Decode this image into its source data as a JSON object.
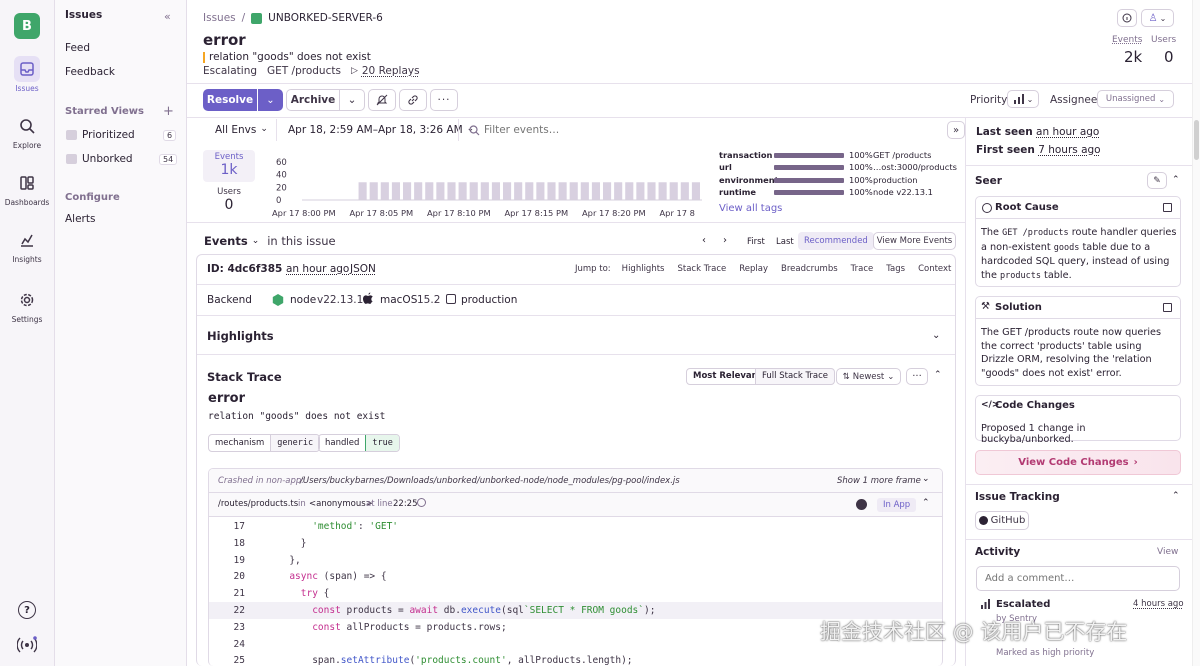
{
  "org_initial": "B",
  "nav": {
    "issues": "Issues",
    "explore": "Explore",
    "dashboards": "Dashboards",
    "insights": "Insights",
    "settings": "Settings"
  },
  "secnav": {
    "title": "Issues",
    "feed": "Feed",
    "feedback": "Feedback",
    "starred_views": "Starred Views",
    "prioritized": "Prioritized",
    "prioritized_count": "6",
    "unborked": "Unborked",
    "unborked_count": "54",
    "configure": "Configure",
    "alerts": "Alerts"
  },
  "breadcrumb": {
    "root": "Issues",
    "project": "UNBORKED-SERVER-6"
  },
  "issue": {
    "title": "error",
    "message": "relation \"goods\" does not exist",
    "status": "Escalating",
    "transaction": "GET /products",
    "replays": "20 Replays",
    "events_label": "Events",
    "events_value": "2k",
    "users_label": "Users",
    "users_value": "0"
  },
  "actions": {
    "resolve": "Resolve",
    "archive": "Archive",
    "priority_label": "Priority",
    "assignee_label": "Assignee",
    "assignee_value": "Unassigned"
  },
  "filters": {
    "envs": "All Envs",
    "range": "Apr 18, 2:59 AM–Apr 18, 3:26 AM",
    "search_placeholder": "Filter events…"
  },
  "stats": {
    "events_label": "Events",
    "events_value": "1k",
    "users_label": "Users",
    "users_value": "0"
  },
  "chart_data": {
    "type": "bar",
    "y_ticks": [
      "60",
      "40",
      "20",
      "0"
    ],
    "ylim": [
      0,
      60
    ],
    "x_ticks": [
      "Apr 17 8:00 PM",
      "Apr 17 8:05 PM",
      "Apr 17 8:10 PM",
      "Apr 17 8:15 PM",
      "Apr 17 8:20 PM",
      "Apr 17 8"
    ],
    "values": [
      0,
      0,
      0,
      0,
      0,
      28,
      28,
      28,
      28,
      28,
      28,
      28,
      28,
      28,
      28,
      28,
      28,
      28,
      28,
      28,
      28,
      28,
      28,
      28,
      28,
      28,
      28,
      28,
      28,
      28,
      28,
      28,
      28,
      28,
      28,
      28
    ]
  },
  "tags": [
    {
      "key": "transaction",
      "pct": "100%",
      "value": "GET /products"
    },
    {
      "key": "url",
      "pct": "100%",
      "value": "…ost:3000/products"
    },
    {
      "key": "environment",
      "pct": "100%",
      "value": "production"
    },
    {
      "key": "runtime",
      "pct": "100%",
      "value": "node v22.13.1"
    }
  ],
  "tags_link": "View all tags",
  "events_bar": {
    "label": "Events",
    "scope": "in this issue",
    "first": "First",
    "last": "Last",
    "recommended": "Recommended",
    "view_more": "View More Events"
  },
  "event": {
    "id_label": "ID: 4dc6f385",
    "time": "an hour ago",
    "json": "JSON",
    "jump_to": "Jump to:",
    "jumps": [
      "Highlights",
      "Stack Trace",
      "Replay",
      "Breadcrumbs",
      "Trace",
      "Tags",
      "Context"
    ],
    "platform": "Backend",
    "runtime_name": "node",
    "runtime_version": "v22.13.1",
    "os_name": "macOS",
    "os_version": "15.2",
    "environment": "production"
  },
  "highlights_title": "Highlights",
  "stack": {
    "title": "Stack Trace",
    "most_relevant": "Most Relevant",
    "full": "Full Stack Trace",
    "sort": "Newest",
    "error_type": "error",
    "error_value": "relation \"goods\" does not exist",
    "mechanism_label": "mechanism",
    "mechanism_value": "generic",
    "handled_label": "handled",
    "handled_value": "true",
    "crashed_prefix": "Crashed in non-app:",
    "crashed_path": "/Users/buckybarnes/Downloads/unborked/unborked-node/node_modules/pg-pool/index.js",
    "show_more": "Show 1 more frame",
    "frame_file": "/routes/products.ts",
    "frame_in": "in",
    "frame_fn": "<anonymous>",
    "frame_at": "at line",
    "frame_line": "22:25",
    "in_app": "In App"
  },
  "code": [
    {
      "n": "17",
      "t": "          'method': 'GET'"
    },
    {
      "n": "18",
      "t": "        }"
    },
    {
      "n": "19",
      "t": "      },"
    },
    {
      "n": "20",
      "t": "      async (span) => {"
    },
    {
      "n": "21",
      "t": "        try {"
    },
    {
      "n": "22",
      "t": "          const products = await db.execute(sql`SELECT * FROM goods`);"
    },
    {
      "n": "23",
      "t": "          const allProducts = products.rows;"
    },
    {
      "n": "24",
      "t": ""
    },
    {
      "n": "25",
      "t": "          span.setAttribute('products.count', allProducts.length);"
    }
  ],
  "sidebar": {
    "last_seen_label": "Last seen",
    "last_seen": "an hour ago",
    "first_seen_label": "First seen",
    "first_seen": "7 hours ago",
    "seer": "Seer",
    "root_cause_title": "Root Cause",
    "root_cause_parts": [
      "The",
      "GET /products",
      "route handler queries a non-existent",
      "goods",
      "table due to a hardcoded SQL query, instead of using the",
      "products",
      "table."
    ],
    "solution_title": "Solution",
    "solution_text": "The GET /products route now queries the correct 'products' table using Drizzle ORM, resolving the 'relation \"goods\" does not exist' error.",
    "code_changes_title": "Code Changes",
    "code_changes_text": "Proposed 1 change in buckyba/unborked.",
    "view_code_changes": "View Code Changes",
    "issue_tracking": "Issue Tracking",
    "github": "GitHub",
    "activity": "Activity",
    "activity_view": "View",
    "comment_placeholder": "Add a comment…",
    "activity_item_title": "Escalated",
    "activity_item_by": "by Sentry",
    "activity_item_time": "4 hours ago",
    "activity_item_note": "Marked as high priority"
  },
  "watermark": "掘金技术社区 @ 该用户已不存在"
}
